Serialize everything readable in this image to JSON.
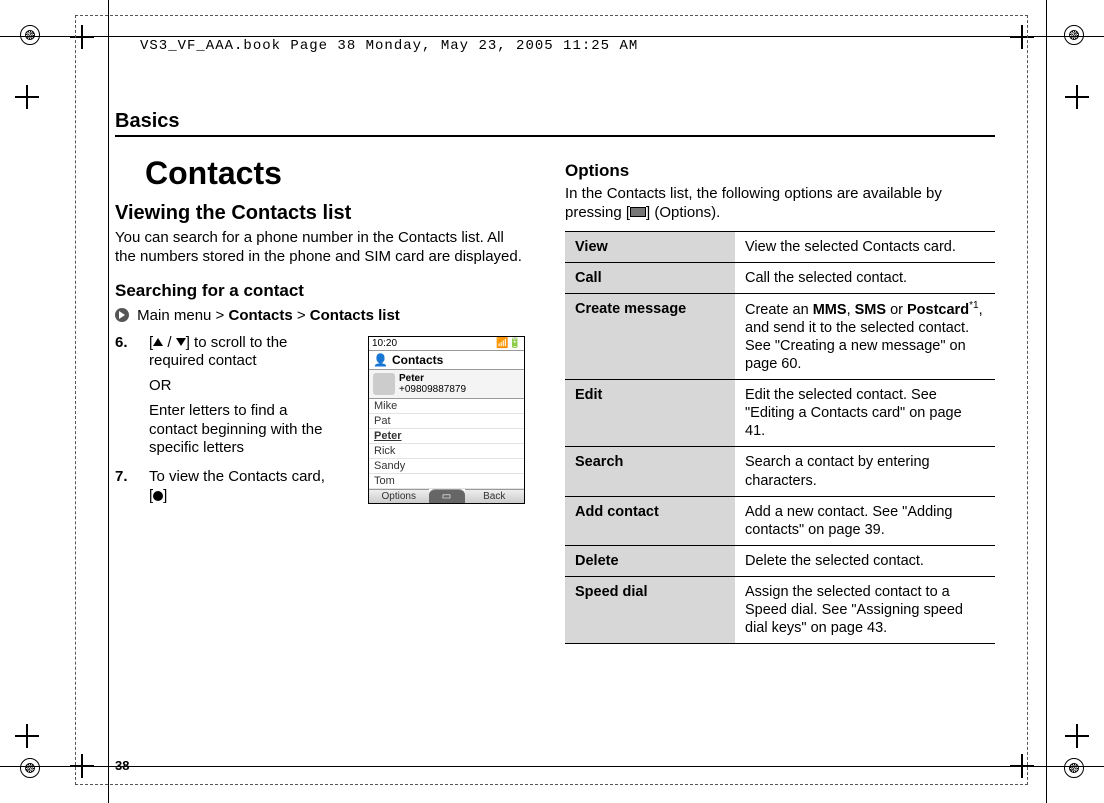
{
  "crop_header": "VS3_VF_AAA.book  Page 38  Monday, May 23, 2005  11:25 AM",
  "section": "Basics",
  "title": "Contacts",
  "h2": "Viewing the Contacts list",
  "intro": "You can search for a phone number in the Contacts list. All the numbers stored in the phone and SIM card are displayed.",
  "h3": "Searching for a contact",
  "nav": {
    "pre": "Main menu >",
    "b1": "Contacts",
    "sep": ">",
    "b2": "Contacts list"
  },
  "steps": {
    "s6_a": "] to scroll to the required contact",
    "s6_or": "OR",
    "s6_b": "Enter letters to find a contact beginning with the specific letters",
    "s7_a": "To view the Contacts card, [",
    "s7_b": "]"
  },
  "phone": {
    "time": "10:20",
    "title": "Contacts",
    "preview_name": "Peter",
    "preview_number": "+09809887879",
    "list": [
      "Mike",
      "Pat",
      "Peter",
      "Rick",
      "Sandy",
      "Tom"
    ],
    "selected_index": 2,
    "soft_left": "Options",
    "soft_mid": "",
    "soft_right": "Back"
  },
  "options_heading": "Options",
  "options_intro_a": "In the Contacts list, the following options are available by pressing [",
  "options_intro_b": "] (Options).",
  "table": [
    {
      "k": "View",
      "v": "View the selected Contacts card."
    },
    {
      "k": "Call",
      "v": "Call the selected contact."
    },
    {
      "k": "Create message",
      "v_pre": "Create an ",
      "v_b1": "MMS",
      "v_mid1": ", ",
      "v_b2": "SMS",
      "v_mid2": " or ",
      "v_b3": "Postcard",
      "v_sup": "*1",
      "v_post": ", and send it to the selected contact. See \"Creating a new message\" on page 60."
    },
    {
      "k": "Edit",
      "v": "Edit the selected contact. See \"Editing a Contacts card\" on page 41."
    },
    {
      "k": "Search",
      "v": "Search a contact by entering characters."
    },
    {
      "k": "Add contact",
      "v": "Add a new contact. See \"Adding contacts\" on page 39."
    },
    {
      "k": "Delete",
      "v": "Delete the selected contact."
    },
    {
      "k": "Speed dial",
      "v": "Assign the selected contact to a Speed dial. See \"Assigning speed dial keys\" on page 43."
    }
  ],
  "page_number": "38"
}
